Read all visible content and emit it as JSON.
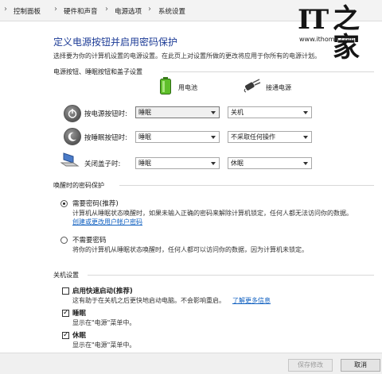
{
  "breadcrumb": [
    "控制面板",
    "硬件和声音",
    "电源选项",
    "系统设置"
  ],
  "watermark": {
    "logo_it": "IT",
    "logo_zh": "之家",
    "url": "www.ithome.com"
  },
  "page": {
    "title": "定义电源按钮并启用密码保护",
    "description": "选择要为你的计算机设置的电源设置。在此页上对设置所做的更改将应用于你所有的电源计划。"
  },
  "power_section": {
    "heading": "电源按钮、睡眠按钮和盖子设置",
    "battery_label": "用电池",
    "plugged_label": "接通电源",
    "rows": [
      {
        "label": "按电源按钮时:",
        "icon": "power-icon",
        "battery": "睡眠",
        "plugged": "关机"
      },
      {
        "label": "按睡眠按钮时:",
        "icon": "sleep-icon",
        "battery": "睡眠",
        "plugged": "不采取任何操作"
      },
      {
        "label": "关闭盖子时:",
        "icon": "laptop-lid-icon",
        "battery": "睡眠",
        "plugged": "休眠"
      }
    ]
  },
  "password_section": {
    "heading": "唤醒时的密码保护",
    "require": {
      "label": "需要密码(推荐)",
      "selected": true,
      "desc1": "计算机从睡眠状态唤醒时，如果未输入正确的密码来解除计算机锁定，任何人都无法访问你的数据。",
      "link": "创建或更改用户帐户密码"
    },
    "no_require": {
      "label": "不需要密码",
      "selected": false,
      "desc": "将你的计算机从睡眠状态唤醒时，任何人都可以访问你的数据，因为计算机未锁定。"
    }
  },
  "shutdown_section": {
    "heading": "关机设置",
    "items": [
      {
        "label": "启用快速启动(推荐)",
        "checked": false,
        "desc": "这有助于在关机之后更快地启动电脑。不会影响重启。",
        "link": "了解更多信息"
      },
      {
        "label": "睡眠",
        "checked": true,
        "desc": "显示在\"电源\"菜单中。"
      },
      {
        "label": "休眠",
        "checked": true,
        "desc": "显示在\"电源\"菜单中。"
      }
    ]
  },
  "footer": {
    "save": "保存修改",
    "cancel": "取消"
  },
  "colors": {
    "title": "#1c3b96",
    "link": "#1060c0",
    "footer": "#f0f0f0"
  }
}
